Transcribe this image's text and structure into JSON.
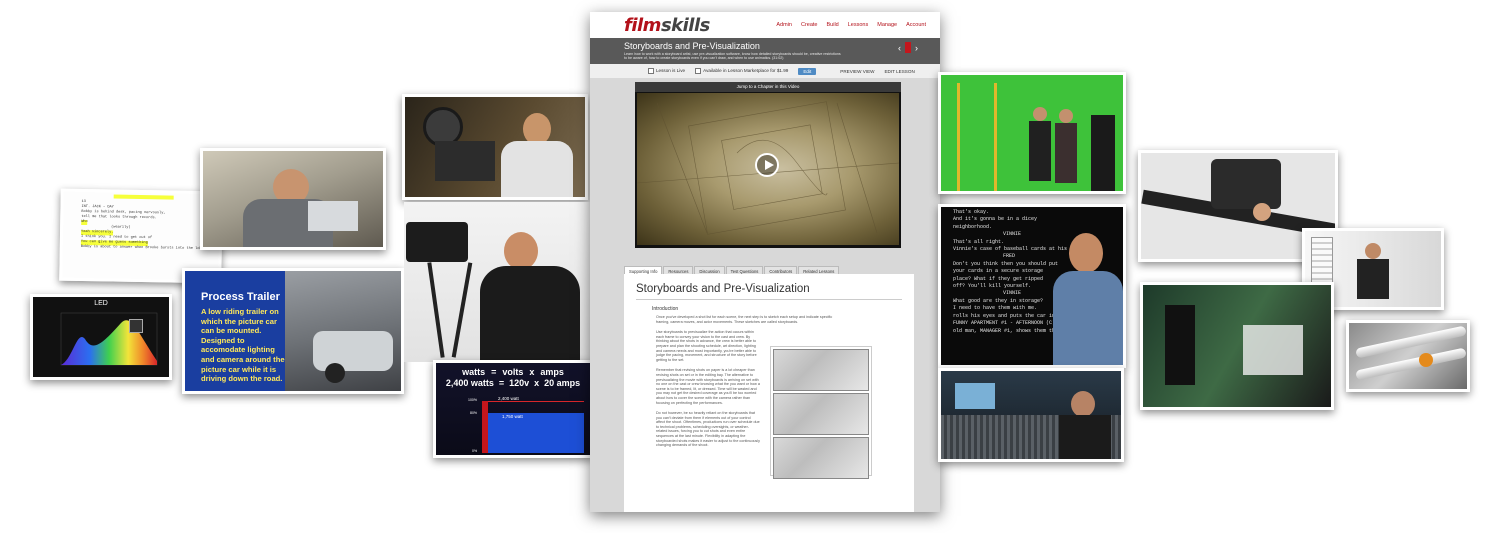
{
  "site": {
    "logo_part1": "film",
    "logo_part2": "skills",
    "nav": [
      "Admin",
      "Create",
      "Build",
      "Lessons",
      "Manage",
      "Account"
    ],
    "lesson_title": "Storyboards and Pre-Visualization",
    "lesson_subtitle": "Learn how to work with a storyboard artist, use pre-visualization software, know how detailed storyboards should be, creative restrictions to be aware of, how to create storyboards even if you can't draw, and when to use animatics. (31:02)",
    "status": {
      "live": "Lesson is Live",
      "marketplace": "Available in Lesson Marketplace for $1.99",
      "edit_label": "Edit",
      "preview": "PREVIEW VIEW",
      "edit_lesson": "EDIT LESSON"
    },
    "jump_label": "Jump to a Chapter in this Video",
    "tabs": [
      "Supporting Info",
      "Resources",
      "Discussion",
      "Test Questions",
      "Contributors",
      "Related Lessons"
    ],
    "content_title": "Storyboards and Pre-Visualization",
    "intro_label": "Introduction",
    "para1": "Once you've developed a shot list for each scene, the next step is to sketch each setup and indicate specific framing, camera moves, and actor movements. These sketches are called storyboards.",
    "para2": "Use storyboards to previsualize the action that occurs within each frame to convey your vision to the cast and crew. By thinking about the shots in advance, the crew is better able to prepare and plan the shooting schedule, art direction, lighting and camera needs and most importantly, you're better able to judge the pacing, movement, and structure of the story before getting to the set.",
    "para3": "Remember that revising shots on paper is a lot cheaper than revising shots on set or in the editing bay. The alternative to previsualizing the movie with storyboards is arriving on set with no one on the cast or crew knowing what the you want or how a scene is to be framed, lit, or dressed. Time will be wasted and you may not get the desired coverage as you'll be too worried about how to cover the scene with the camera rather than focusing on perfecting the performances.",
    "para4": "Do not however, be so heavily reliant on the storyboards that you can't deviate from them if elements out of your control affect the shoot. Oftentimes, productions run over schedule due to technical problems, scheduling oversights, or weather-related issues, forcing you to cut shots and even entire sequences at the last minute. Flexibility in adapting the storyboarded shots makes it easier to adjust to the continuously changing demands of the shoot."
  },
  "cards": {
    "led_title": "LED",
    "process_title": "Process Trailer",
    "process_body": "A low riding trailer on which the picture car can be mounted. Designed to accomodate lighting and camera around the picture car while it is driving down the road.",
    "watts_row1": [
      "watts",
      "=",
      "volts",
      "x",
      "amps"
    ],
    "watts_row2": [
      "2,400 watts",
      "=",
      "120v",
      "x",
      "20 amps"
    ],
    "bar_labels": [
      "2,400 watt",
      "1,750 watt"
    ],
    "bar_axis": [
      "100%",
      "80%",
      "0%"
    ],
    "script_lines": [
      "That's okay.",
      "And it's gonna be in a dicey",
      "neighborhood.",
      "VINNIE",
      "That's all right.",
      "FRED",
      "Vinnie's case of baseball cards at his",
      "FRED",
      "Don't you think then you should put",
      "your cards in a secure storage",
      "place? What if they get ripped",
      "off? You'll kill yourself.",
      "VINNIE",
      "What good are they in storage?",
      "I need to have them with me.",
      "rolls his eyes and puts the car in",
      "FUNNY APARTMENT #1 - AFTERNOON (C)",
      "old man, MANAGER #1, shows them the"
    ],
    "doc_lines": [
      "13",
      "INT. JACK - DAY",
      "Bobby is behind desk, pacing nervously,",
      "in a small rooms",
      "tell me that looks through records.",
      "Who",
      "(wearily)",
      "Yeah sincerely.",
      "I think you. I need to get out of",
      "here.",
      "Bobby",
      "You can give me guess something",
      "Bobby is about to answer when Brooke bursts into the lobby"
    ],
    "lines_colors": {
      "green": "#5ec62e",
      "red": "#c4161c",
      "blue": "#1d4fd6"
    }
  }
}
